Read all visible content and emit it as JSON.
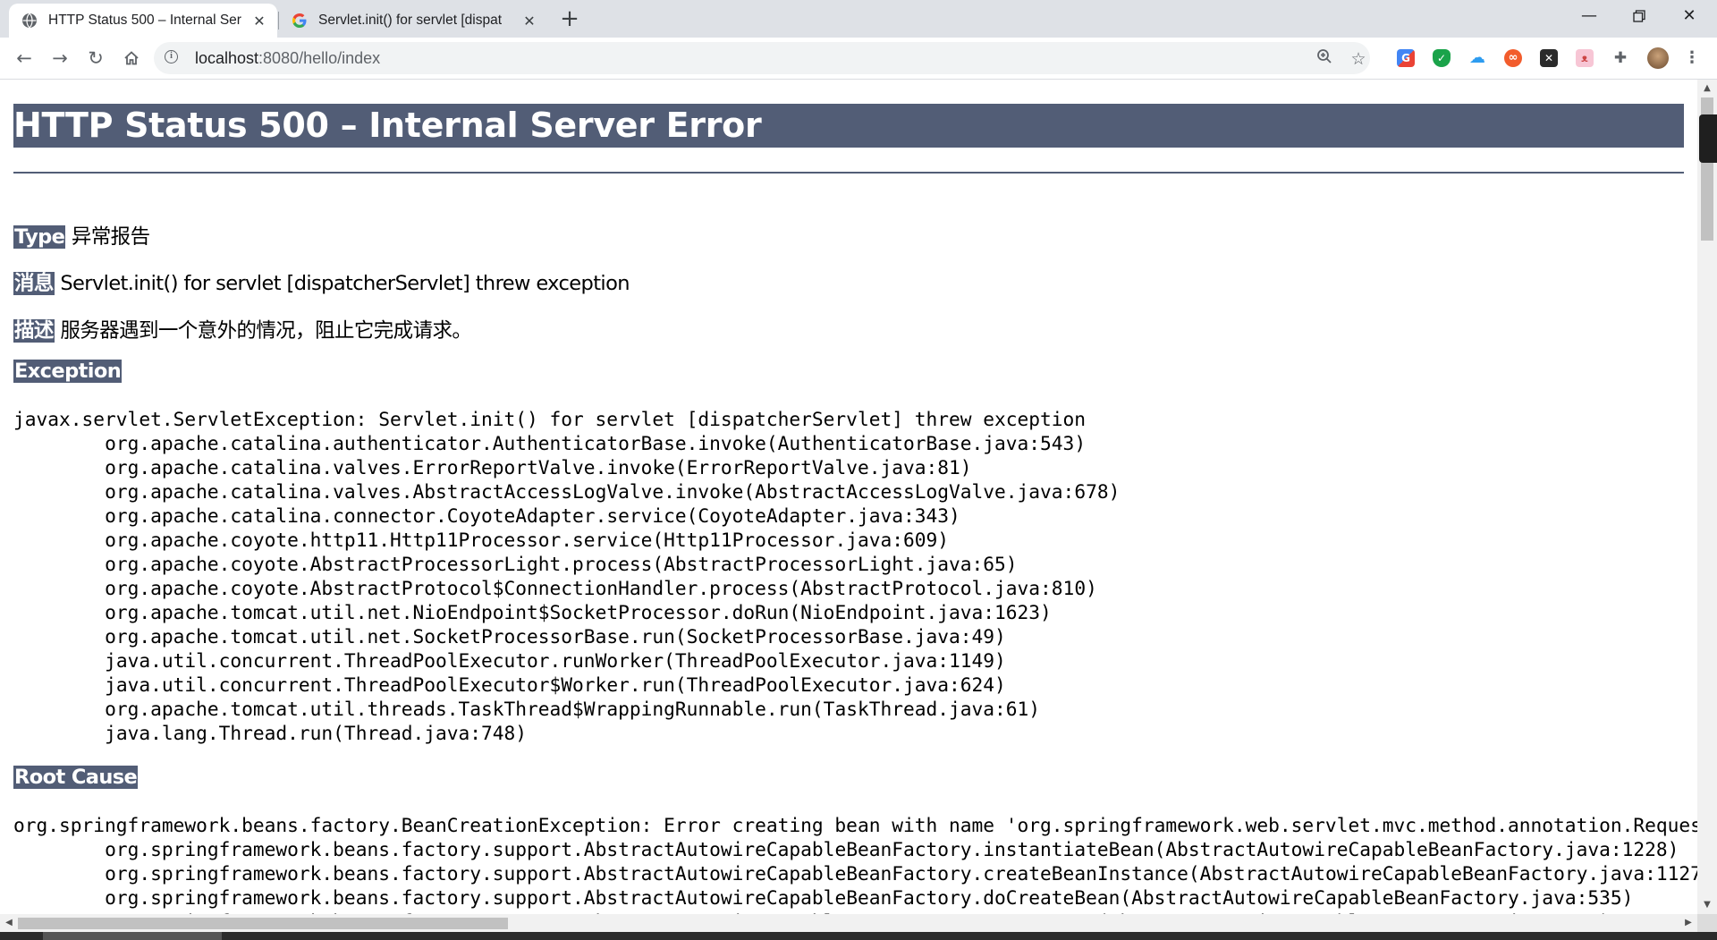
{
  "browser": {
    "tabs": [
      {
        "title": "HTTP Status 500 – Internal Ser",
        "favicon": "globe-icon",
        "active": true
      },
      {
        "title": "Servlet.init() for servlet [dispat",
        "favicon": "google-g-icon",
        "active": false
      }
    ],
    "new_tab_label": "+",
    "url_host": "localhost",
    "url_path": ":8080/hello/index",
    "icons": {
      "back": "arrow-left-icon",
      "forward": "arrow-right-icon",
      "reload": "reload-icon",
      "home": "home-icon",
      "site_info": "info-icon",
      "zoom": "zoom-icon",
      "bookmark": "star-icon",
      "extensions": [
        "google-translate-icon",
        "shield-icon",
        "cloud-icon",
        "infinity-icon",
        "x-icon",
        "cat-icon",
        "puzzle-icon"
      ],
      "profile": "avatar-icon",
      "menu": "kebab-menu-icon"
    },
    "window_controls": [
      "minimize-icon",
      "restore-icon",
      "close-icon"
    ]
  },
  "page": {
    "title": "HTTP Status 500 – Internal Server Error",
    "type_label": "Type",
    "type_value": "异常报告",
    "message_label": "消息",
    "message_value": "Servlet.init() for servlet [dispatcherServlet] threw exception",
    "description_label": "描述",
    "description_value": "服务器遇到一个意外的情况，阻止它完成请求。",
    "exception_label": "Exception",
    "exception_trace": "javax.servlet.ServletException: Servlet.init() for servlet [dispatcherServlet] threw exception\n\torg.apache.catalina.authenticator.AuthenticatorBase.invoke(AuthenticatorBase.java:543)\n\torg.apache.catalina.valves.ErrorReportValve.invoke(ErrorReportValve.java:81)\n\torg.apache.catalina.valves.AbstractAccessLogValve.invoke(AbstractAccessLogValve.java:678)\n\torg.apache.catalina.connector.CoyoteAdapter.service(CoyoteAdapter.java:343)\n\torg.apache.coyote.http11.Http11Processor.service(Http11Processor.java:609)\n\torg.apache.coyote.AbstractProcessorLight.process(AbstractProcessorLight.java:65)\n\torg.apache.coyote.AbstractProtocol$ConnectionHandler.process(AbstractProtocol.java:810)\n\torg.apache.tomcat.util.net.NioEndpoint$SocketProcessor.doRun(NioEndpoint.java:1623)\n\torg.apache.tomcat.util.net.SocketProcessorBase.run(SocketProcessorBase.java:49)\n\tjava.util.concurrent.ThreadPoolExecutor.runWorker(ThreadPoolExecutor.java:1149)\n\tjava.util.concurrent.ThreadPoolExecutor$Worker.run(ThreadPoolExecutor.java:624)\n\torg.apache.tomcat.util.threads.TaskThread$WrappingRunnable.run(TaskThread.java:61)\n\tjava.lang.Thread.run(Thread.java:748)",
    "root_cause_label": "Root Cause",
    "root_cause_trace": "org.springframework.beans.factory.BeanCreationException: Error creating bean with name 'org.springframework.web.servlet.mvc.method.annotation.RequestMappin\n\torg.springframework.beans.factory.support.AbstractAutowireCapableBeanFactory.instantiateBean(AbstractAutowireCapableBeanFactory.java:1228)\n\torg.springframework.beans.factory.support.AbstractAutowireCapableBeanFactory.createBeanInstance(AbstractAutowireCapableBeanFactory.java:1127)\n\torg.springframework.beans.factory.support.AbstractAutowireCapableBeanFactory.doCreateBean(AbstractAutowireCapableBeanFactory.java:535)\n\torg.springframework.beans.factory.support.AbstractAutowireCapableBeanFactory.createBean(AbstractAutowireCapableBeanFactory.java:495)"
  },
  "colors": {
    "header_bg": "#525d76",
    "tabstrip_bg": "#dee1e6"
  }
}
